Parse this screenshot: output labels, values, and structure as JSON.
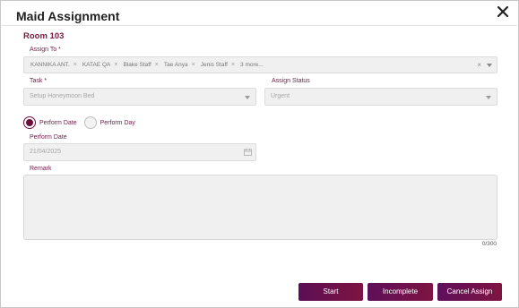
{
  "dialog": {
    "title": "Maid Assignment",
    "room": "Room 103"
  },
  "assign_to": {
    "label": "Assign To *",
    "chips": [
      "KANNIKA ANT.",
      "KATAE QA",
      "Blake Staff",
      "Tae Anya",
      "Jenis Staff"
    ],
    "more": "3 more...",
    "clear_symbol": "×"
  },
  "task": {
    "label": "Task *",
    "value": "Setup Honeymoon Bed"
  },
  "assign_status": {
    "label": "Assign Status",
    "value": "Urgent"
  },
  "perform_mode": {
    "options": [
      "Perform Date",
      "Perform Day"
    ],
    "selected": "Perform Date"
  },
  "perform_date": {
    "label": "Perform Date",
    "value": "21/04/2025"
  },
  "remark": {
    "label": "Remark",
    "value": "",
    "counter": "0/300"
  },
  "buttons": {
    "start": "Start",
    "incomplete": "Incomplete",
    "cancel": "Cancel Assign"
  },
  "colors": {
    "accent": "#6b0f3a",
    "button_gradient_start": "#5c0e55",
    "button_gradient_end": "#7d1440",
    "field_bg": "#f0f0f0"
  },
  "icons": {
    "close": "close-icon",
    "calendar": "calendar-icon",
    "dropdown": "chevron-down-icon"
  }
}
